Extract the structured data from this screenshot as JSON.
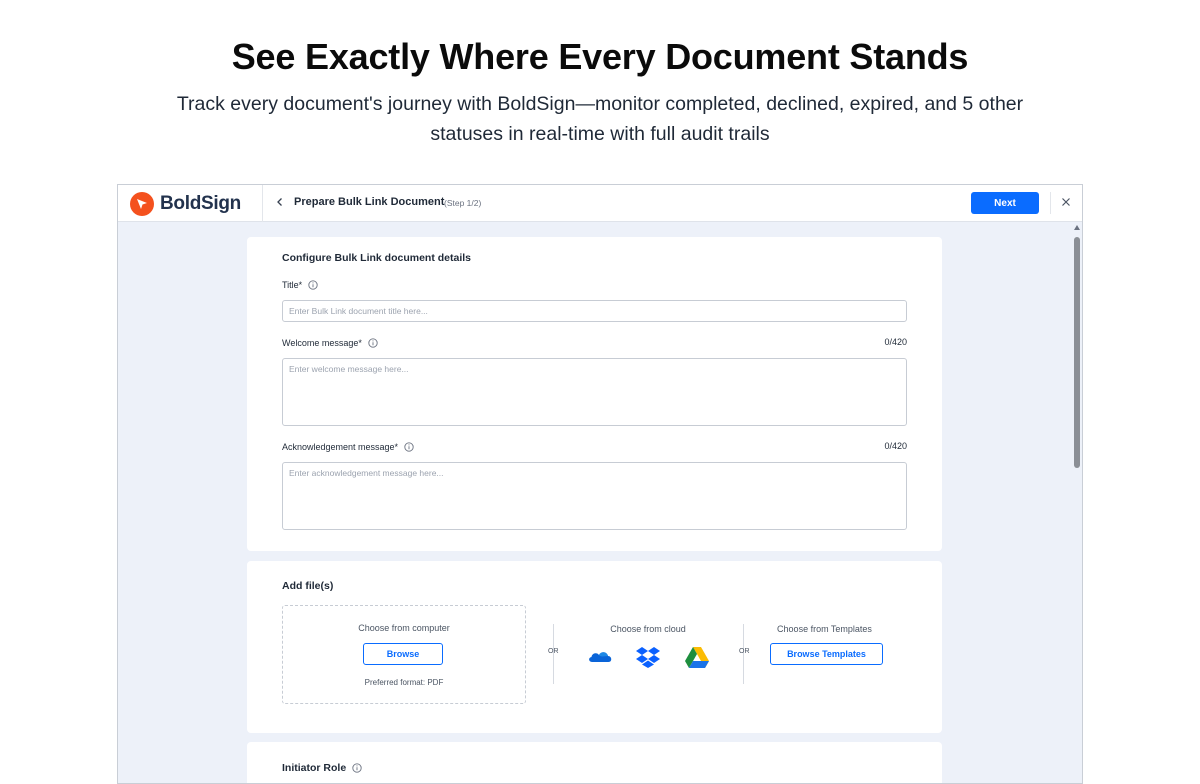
{
  "hero": {
    "title": "See Exactly Where Every Document Stands",
    "subtitle": "Track every document's journey with BoldSign—monitor completed, declined, expired, and 5 other statuses in real-time with full audit trails"
  },
  "app": {
    "brand": "BoldSign",
    "page_title": "Prepare Bulk Link Document",
    "step": "(Step 1/2)",
    "next_label": "Next",
    "accent_color": "#0a6cff",
    "brand_color": "#f4511e"
  },
  "details": {
    "heading": "Configure Bulk Link document details",
    "title_label": "Title*",
    "title_placeholder": "Enter Bulk Link document title here...",
    "welcome_label": "Welcome message*",
    "welcome_counter": "0/420",
    "welcome_placeholder": "Enter welcome message here...",
    "ack_label": "Acknowledgement message*",
    "ack_counter": "0/420",
    "ack_placeholder": "Enter acknowledgement message here..."
  },
  "files": {
    "heading": "Add file(s)",
    "computer_heading": "Choose from computer",
    "browse_label": "Browse",
    "preferred_format": "Preferred format: PDF",
    "or_label": "OR",
    "cloud_heading": "Choose from cloud",
    "cloud_icons": [
      "onedrive-icon",
      "dropbox-icon",
      "google-drive-icon"
    ],
    "templates_heading": "Choose from Templates",
    "browse_templates_label": "Browse Templates"
  },
  "initiator": {
    "heading": "Initiator Role"
  }
}
